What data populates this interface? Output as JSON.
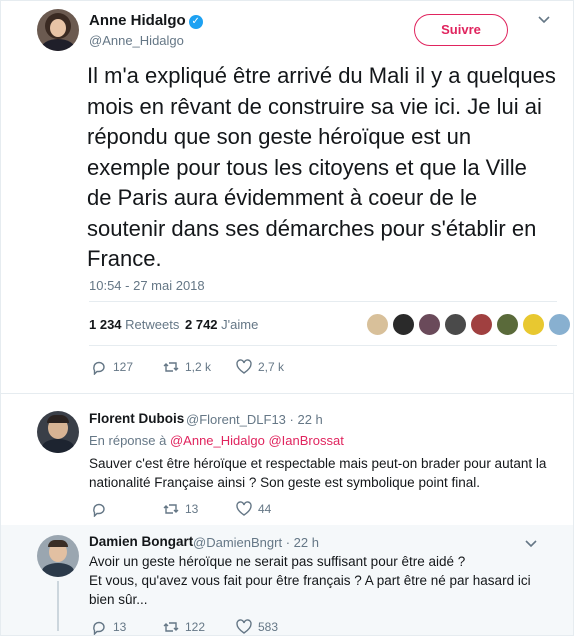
{
  "main_tweet": {
    "author_name": "Anne Hidalgo",
    "author_handle": "@Anne_Hidalgo",
    "follow_label": "Suivre",
    "text": "Il m'a expliqué être arrivé du Mali il y a quelques mois en rêvant de construire sa vie ici. Je lui ai répondu que son geste héroïque est un exemple pour tous les citoyens et que la Ville de Paris aura évidemment à coeur de le soutenir dans ses démarches pour s'établir en France.",
    "timestamp": "10:54 - 27 mai 2018",
    "retweets_count": "1 234",
    "retweets_label": "Retweets",
    "likes_count": "2 742",
    "likes_label": "J'aime",
    "actions": {
      "replies": "127",
      "retweets": "1,2 k",
      "likes": "2,7 k"
    }
  },
  "replies": [
    {
      "author_name": "Florent Dubois",
      "author_handle": "@Florent_DLF13",
      "time": "· 22 h",
      "in_reply_prefix": "En réponse à",
      "in_reply_to_1": "@Anne_Hidalgo",
      "in_reply_to_2": "@IanBrossat",
      "text": "Sauver c'est être héroïque et respectable mais peut-on brader pour autant la nationalité Française ainsi ? Son geste est symbolique point final.",
      "actions": {
        "replies": "",
        "retweets": "13",
        "likes": "44"
      }
    },
    {
      "author_name": "Damien Bongart",
      "author_handle": "@DamienBngrt",
      "time": "· 22 h",
      "text_line1": "Avoir un geste héroïque ne serait pas suffisant pour être aidé ?",
      "text_line2": "Et vous, qu'avez vous fait pour être français ? A part être né par hasard ici bien sûr...",
      "actions": {
        "replies": "13",
        "retweets": "122",
        "likes": "583"
      }
    }
  ],
  "icons": {
    "verified": "verified-badge-icon",
    "reply": "reply-icon",
    "retweet": "retweet-icon",
    "like": "heart-icon",
    "more": "chevron-down-icon"
  },
  "colors": {
    "accent": "#e0245e",
    "verified": "#1da1f2",
    "muted": "#657786"
  }
}
